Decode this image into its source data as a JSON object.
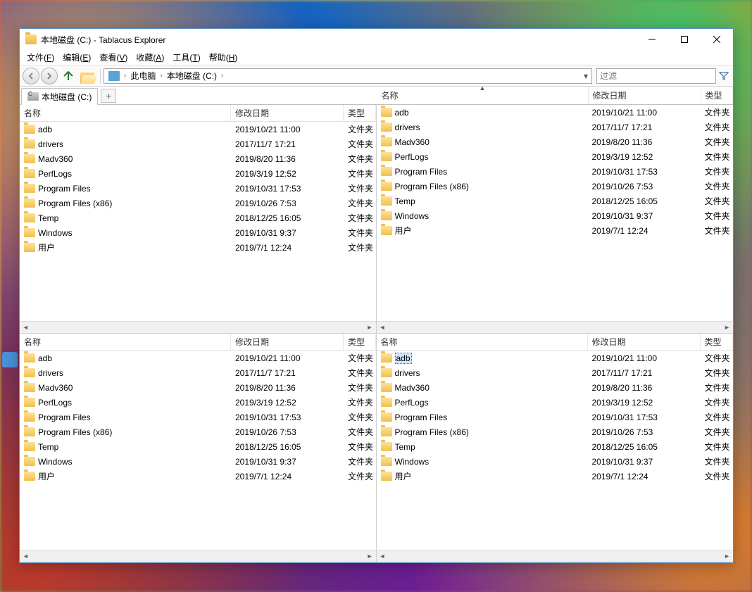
{
  "window": {
    "title": "本地磁盘 (C:) - Tablacus Explorer"
  },
  "menu": {
    "file": "文件(F)",
    "edit": "编辑(E)",
    "view": "查看(V)",
    "favorites": "收藏(A)",
    "tools": "工具(T)",
    "help": "帮助(H)"
  },
  "breadcrumb": {
    "pc": "此电脑",
    "drive": "本地磁盘 (C:)"
  },
  "filter": {
    "placeholder": "过滤"
  },
  "tab": {
    "label": "本地磁盘 (C:)",
    "plus": "+"
  },
  "columns": {
    "name": "名称",
    "date": "修改日期",
    "type": "类型"
  },
  "type_folder": "文件夹",
  "items": [
    {
      "name": "adb",
      "date": "2019/10/21 11:00"
    },
    {
      "name": "drivers",
      "date": "2017/11/7 17:21"
    },
    {
      "name": "Madv360",
      "date": "2019/8/20 11:36"
    },
    {
      "name": "PerfLogs",
      "date": "2019/3/19 12:52"
    },
    {
      "name": "Program Files",
      "date": "2019/10/31 17:53"
    },
    {
      "name": "Program Files (x86)",
      "date": "2019/10/26 7:53"
    },
    {
      "name": "Temp",
      "date": "2018/12/25 16:05"
    },
    {
      "name": "Windows",
      "date": "2019/10/31 9:37"
    },
    {
      "name": "用户",
      "date": "2019/7/1 12:24"
    }
  ]
}
